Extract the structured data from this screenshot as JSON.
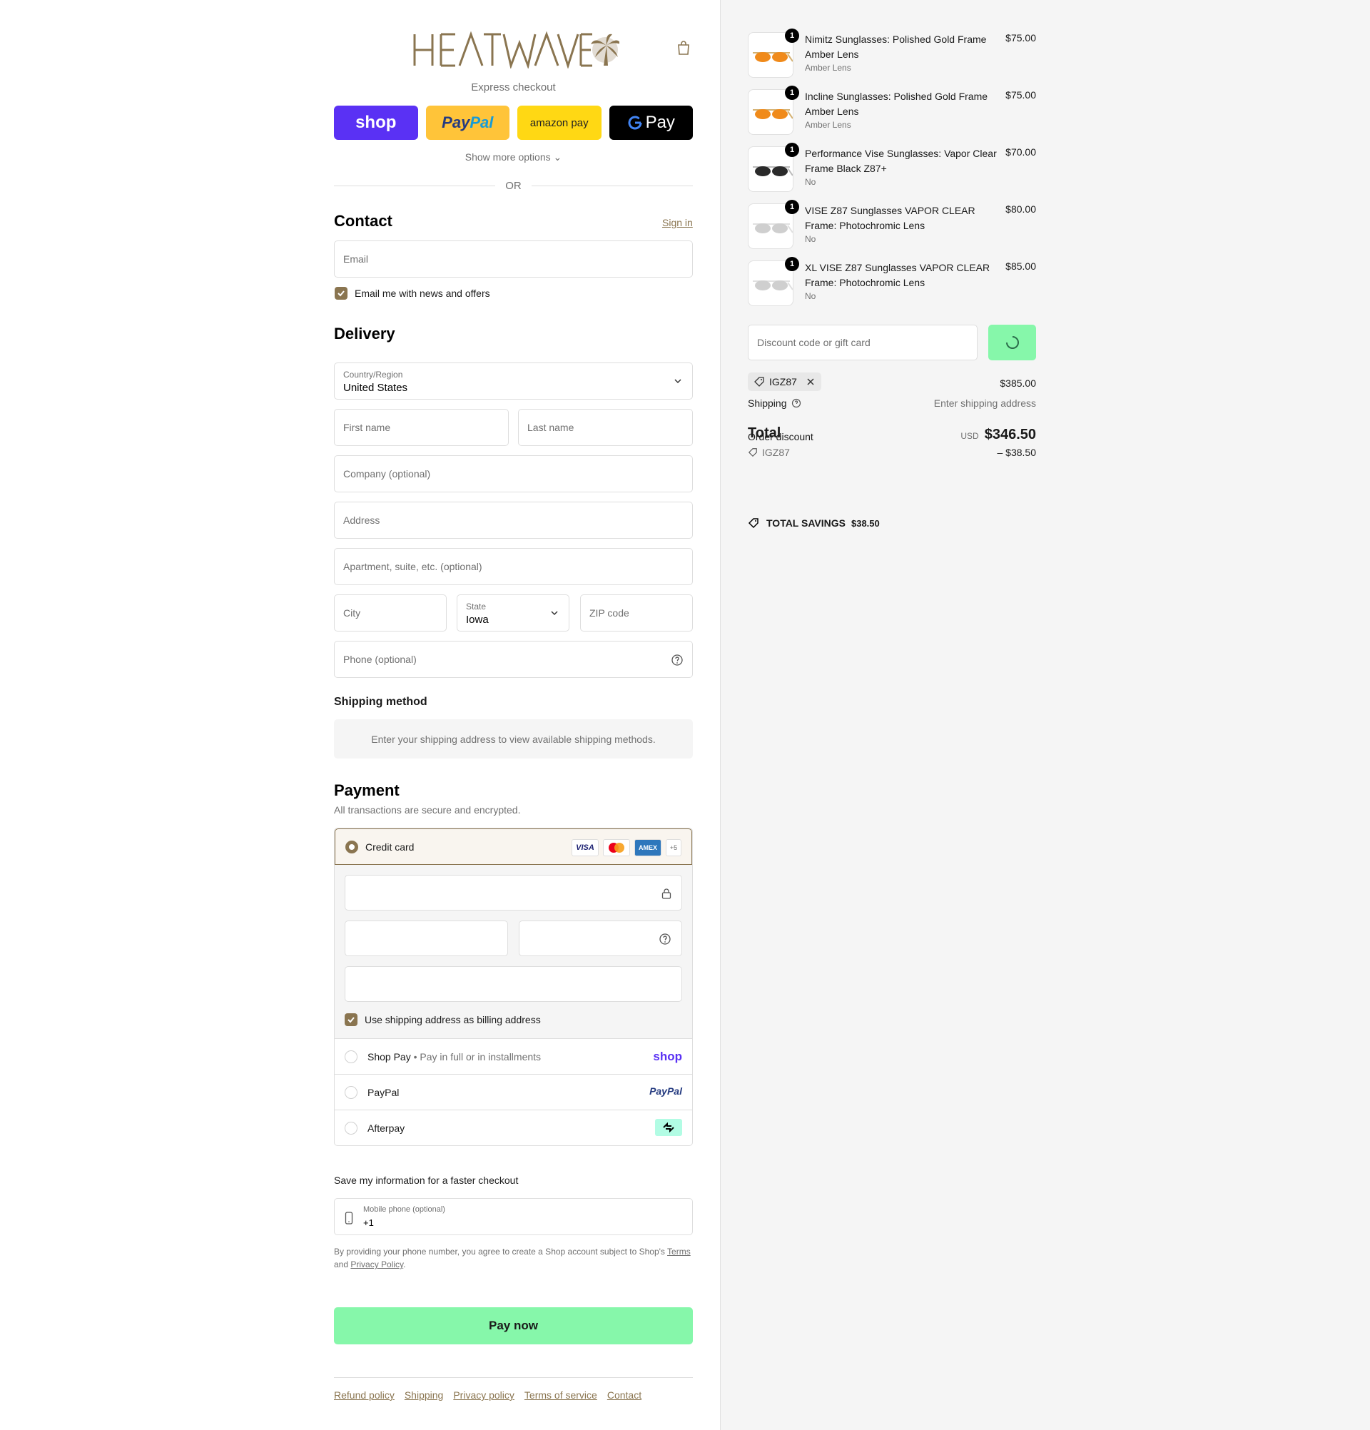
{
  "brand": {
    "name": "HEATWAVE",
    "accent": "#8a7550",
    "green": "#86f7aa"
  },
  "express": {
    "title": "Express checkout",
    "buttons": {
      "shop": "shop",
      "paypal_a": "Pay",
      "paypal_b": "Pal",
      "amazon": "amazon pay",
      "gpay": "Pay"
    },
    "show_more": "Show more options",
    "or": "OR"
  },
  "contact": {
    "title": "Contact",
    "sign_in": "Sign in",
    "email_placeholder": "Email",
    "news_label": "Email me with news and offers"
  },
  "delivery": {
    "title": "Delivery",
    "country_label": "Country/Region",
    "country_value": "United States",
    "first_name": "First name",
    "last_name": "Last name",
    "company": "Company (optional)",
    "address": "Address",
    "apartment": "Apartment, suite, etc. (optional)",
    "city": "City",
    "state_label": "State",
    "state_value": "Iowa",
    "zip": "ZIP code",
    "phone": "Phone (optional)"
  },
  "shipping_method": {
    "title": "Shipping method",
    "message": "Enter your shipping address to view available shipping methods."
  },
  "payment": {
    "title": "Payment",
    "subtitle": "All transactions are secure and encrypted.",
    "credit_card": "Credit card",
    "cards": [
      "VISA",
      "MC",
      "AMEX",
      "+5"
    ],
    "billing_label": "Use shipping address as billing address",
    "shop_pay": "Shop Pay",
    "shop_pay_note": "Pay in full or in installments",
    "shop_brand": "shop",
    "paypal": "PayPal",
    "paypal_brand": "PayPal",
    "afterpay": "Afterpay"
  },
  "save_info": {
    "title": "Save my information for a faster checkout",
    "mobile_label": "Mobile phone (optional)",
    "mobile_value": "+1",
    "legal_a": "By providing your phone number, you agree to create a Shop account subject to Shop's",
    "terms": "Terms",
    "and": "and",
    "privacy": "Privacy Policy",
    "period": "."
  },
  "pay_now": "Pay now",
  "footer_links": [
    "Refund policy",
    "Shipping",
    "Privacy policy",
    "Terms of service",
    "Contact"
  ],
  "cart": {
    "items": [
      {
        "name": "Nimitz Sunglasses: Polished Gold Frame Amber Lens",
        "variant": "Amber Lens",
        "price": "$75.00",
        "qty": "1",
        "lens": "#f08a1a",
        "frame": "#d4b070"
      },
      {
        "name": "Incline Sunglasses: Polished Gold Frame Amber Lens",
        "variant": "Amber Lens",
        "price": "$75.00",
        "qty": "1",
        "lens": "#f08a1a",
        "frame": "#d4b070"
      },
      {
        "name": "Performance Vise Sunglasses: Vapor Clear Frame Black Z87+",
        "variant": "No",
        "price": "$70.00",
        "qty": "1",
        "lens": "#2a2a2a",
        "frame": "#bbbbbb"
      },
      {
        "name": "VISE Z87 Sunglasses VAPOR CLEAR Frame: Photochromic Lens",
        "variant": "No",
        "price": "$80.00",
        "qty": "1",
        "lens": "#cfcfcf",
        "frame": "#e0e0e0"
      },
      {
        "name": "XL VISE Z87 Sunglasses VAPOR CLEAR Frame: Photochromic Lens",
        "variant": "No",
        "price": "$85.00",
        "qty": "1",
        "lens": "#cfcfcf",
        "frame": "#e0e0e0"
      }
    ],
    "discount_placeholder": "Discount code or gift card",
    "applied_code": "IGZ87",
    "subtotal_value": "$385.00",
    "shipping_label": "Shipping",
    "shipping_value": "Enter shipping address",
    "total_label": "Total",
    "order_discount_label": "Order discount",
    "currency": "USD",
    "total_value": "$346.50",
    "discount_code": "IGZ87",
    "discount_value": "– $38.50",
    "savings_label": "TOTAL SAVINGS",
    "savings_value": "$38.50"
  }
}
